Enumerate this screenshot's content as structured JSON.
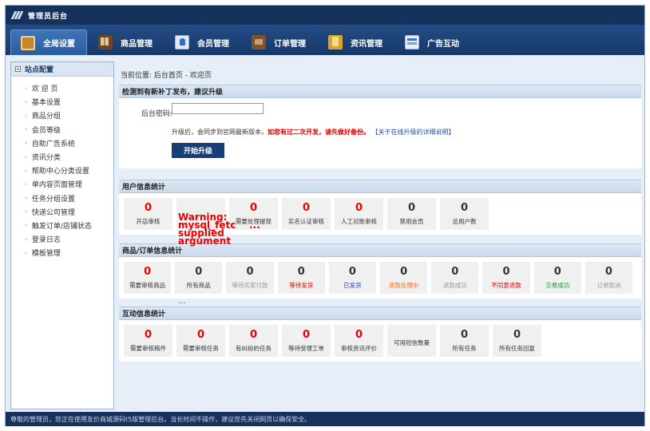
{
  "app": {
    "title": "管理员后台"
  },
  "nav": {
    "tabs": [
      {
        "label": "全局设置",
        "icon": "settings-icon"
      },
      {
        "label": "商品管理",
        "icon": "goods-icon"
      },
      {
        "label": "会员管理",
        "icon": "member-icon"
      },
      {
        "label": "订单管理",
        "icon": "order-icon"
      },
      {
        "label": "资讯管理",
        "icon": "news-icon"
      },
      {
        "label": "广告互动",
        "icon": "ad-icon"
      }
    ]
  },
  "sidebar": {
    "title": "站点配置",
    "items": [
      {
        "label": "欢 迎 页"
      },
      {
        "label": "基本设置"
      },
      {
        "label": "商品分组"
      },
      {
        "label": "会员等级"
      },
      {
        "label": "自助广告系统"
      },
      {
        "label": "资讯分类"
      },
      {
        "label": "帮助中心分类设置"
      },
      {
        "label": "单内容页面管理"
      },
      {
        "label": "任务分组设置"
      },
      {
        "label": "快递公司管理"
      },
      {
        "label": "触发订单/店铺状态"
      },
      {
        "label": "登录日志"
      },
      {
        "label": "模板管理"
      }
    ]
  },
  "breadcrumb": "当前位置: 后台首页 - 欢迎页",
  "upgrade": {
    "title": "检测到有新补丁发布，建议升级",
    "password_label": "后台密码:",
    "password_value": "",
    "note_plain": "升级后，会同步到官网最新版本，",
    "note_red": "如您有过二次开发，请先做好备份。",
    "note_link": "【关于在线升级的详细说明】",
    "button": "开始升级"
  },
  "warning": {
    "text": "Warning:\nmysql_fetc    ...  \nsupplied\nargument",
    "text2": "..."
  },
  "user_stats": {
    "title": "用户信息统计",
    "cards": [
      {
        "value": "0",
        "label": "开店审核",
        "num_color": "red",
        "label_color": ""
      },
      {
        "value": "",
        "label": "",
        "num_color": "",
        "label_color": ""
      },
      {
        "value": "0",
        "label": "需要处理提现",
        "num_color": "red",
        "label_color": ""
      },
      {
        "value": "0",
        "label": "实名认证审核",
        "num_color": "red",
        "label_color": ""
      },
      {
        "value": "0",
        "label": "人工对账审核",
        "num_color": "red",
        "label_color": ""
      },
      {
        "value": "0",
        "label": "禁用会员",
        "num_color": "",
        "label_color": ""
      },
      {
        "value": "0",
        "label": "总用户数",
        "num_color": "",
        "label_color": ""
      }
    ]
  },
  "goods_stats": {
    "title": "商品/订单信息统计",
    "cards": [
      {
        "value": "0",
        "label": "需要审核商品",
        "num_color": "red",
        "label_color": ""
      },
      {
        "value": "0",
        "label": "所有商品",
        "num_color": "",
        "label_color": ""
      },
      {
        "value": "0",
        "label": "等待买家付款",
        "num_color": "",
        "label_color": "gray"
      },
      {
        "value": "0",
        "label": "等待发货",
        "num_color": "",
        "label_color": "red"
      },
      {
        "value": "0",
        "label": "已发货",
        "num_color": "",
        "label_color": "blue"
      },
      {
        "value": "0",
        "label": "退款处理中",
        "num_color": "",
        "label_color": "orange"
      },
      {
        "value": "0",
        "label": "退款成功",
        "num_color": "",
        "label_color": "gray"
      },
      {
        "value": "0",
        "label": "不同意退款",
        "num_color": "",
        "label_color": "red"
      },
      {
        "value": "0",
        "label": "交易成功",
        "num_color": "",
        "label_color": "green"
      },
      {
        "value": "0",
        "label": "订单取消",
        "num_color": "",
        "label_color": "gray"
      }
    ]
  },
  "interact_stats": {
    "title": "互动信息统计",
    "cards": [
      {
        "value": "0",
        "label": "需要审核稿件",
        "num_color": "red",
        "label_color": ""
      },
      {
        "value": "0",
        "label": "需要审核任务",
        "num_color": "red",
        "label_color": ""
      },
      {
        "value": "0",
        "label": "有纠纷的任务",
        "num_color": "red",
        "label_color": ""
      },
      {
        "value": "0",
        "label": "等待受理工单",
        "num_color": "red",
        "label_color": ""
      },
      {
        "value": "0",
        "label": "审核资讯评价",
        "num_color": "red",
        "label_color": ""
      },
      {
        "value": "",
        "label": "可用短信数量",
        "num_color": "",
        "label_color": ""
      },
      {
        "value": "0",
        "label": "所有任务",
        "num_color": "",
        "label_color": ""
      },
      {
        "value": "0",
        "label": "所有任务回复",
        "num_color": "",
        "label_color": ""
      }
    ]
  },
  "footer": {
    "text": "尊敬的管理员，您正在使用友价商城源码t5版管理后台。当长时间不操作，建议您先关闭网页以确保安全。"
  }
}
